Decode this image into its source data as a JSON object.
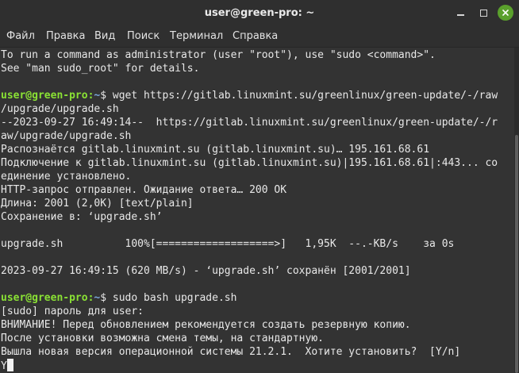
{
  "window": {
    "title": "user@green-pro: ~"
  },
  "menubar": [
    "Файл",
    "Правка",
    "Вид",
    "Поиск",
    "Терминал",
    "Справка"
  ],
  "colors": {
    "prompt_user": "#8ae234",
    "prompt_path": "#7aa6da",
    "background": "#333333",
    "text": "#e8e8e8"
  },
  "terminal": {
    "prompt_user": "user@green-pro",
    "prompt_sep": ":",
    "prompt_path": "~",
    "prompt_end": "$ ",
    "lines": [
      {
        "text": "To run a command as administrator (user \"root\"), use \"sudo <command>\"."
      },
      {
        "text": "See \"man sudo_root\" for details."
      },
      {
        "text": ""
      },
      {
        "prompt": true,
        "text": "wget https://gitlab.linuxmint.su/greenlinux/green-update/-/raw"
      },
      {
        "text": "/upgrade/upgrade.sh"
      },
      {
        "text": "--2023-09-27 16:49:14--  https://gitlab.linuxmint.su/greenlinux/green-update/-/r"
      },
      {
        "text": "aw/upgrade/upgrade.sh"
      },
      {
        "text": "Распознаётся gitlab.linuxmint.su (gitlab.linuxmint.su)… 195.161.68.61"
      },
      {
        "text": "Подключение к gitlab.linuxmint.su (gitlab.linuxmint.su)|195.161.68.61|:443... со"
      },
      {
        "text": "единение установлено."
      },
      {
        "text": "HTTP-запрос отправлен. Ожидание ответа… 200 OK"
      },
      {
        "text": "Длина: 2001 (2,0K) [text/plain]"
      },
      {
        "text": "Сохранение в: ‘upgrade.sh’"
      },
      {
        "text": ""
      },
      {
        "text": "upgrade.sh          100%[===================>]   1,95K  --.-KB/s    за 0s"
      },
      {
        "text": ""
      },
      {
        "text": "2023-09-27 16:49:15 (620 MB/s) - ‘upgrade.sh’ сохранён [2001/2001]"
      },
      {
        "text": ""
      },
      {
        "prompt": true,
        "text": "sudo bash upgrade.sh"
      },
      {
        "text": "[sudo] пароль для user:"
      },
      {
        "text": "ВНИМАНИЕ! Перед обновлением рекомендуется создать резервную копию."
      },
      {
        "text": "После установки возможна смена темы, на стандартную."
      },
      {
        "text": "Вышла новая версия операционной системы 21.2.1.  Хотите установить?  [Y/n]"
      },
      {
        "text": "Y",
        "cursor": true
      }
    ]
  }
}
